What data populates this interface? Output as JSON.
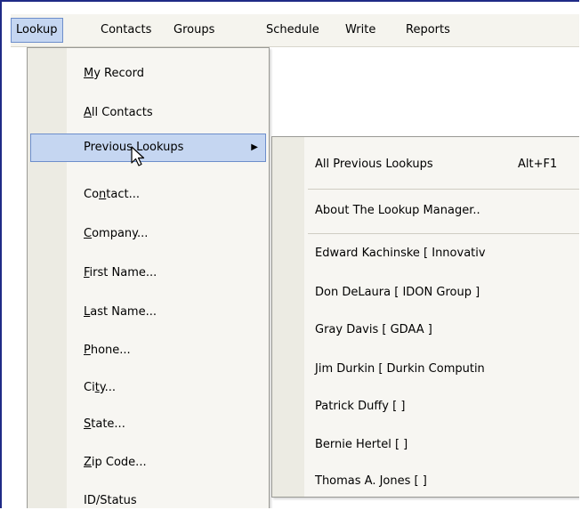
{
  "menubar": {
    "items": [
      "Lookup",
      "Contacts",
      "Groups",
      "Schedule",
      "Write",
      "Reports"
    ]
  },
  "lookup_menu": {
    "items": [
      {
        "pre": "",
        "ul": "M",
        "post": "y Record"
      },
      {
        "pre": "",
        "ul": "A",
        "post": "ll Contacts"
      },
      {
        "pre": "Previous Lookups",
        "ul": "",
        "post": "",
        "submenu": true
      },
      {
        "pre": "Co",
        "ul": "n",
        "post": "tact..."
      },
      {
        "pre": "",
        "ul": "C",
        "post": "ompany..."
      },
      {
        "pre": "",
        "ul": "F",
        "post": "irst Name..."
      },
      {
        "pre": "",
        "ul": "L",
        "post": "ast Name..."
      },
      {
        "pre": "",
        "ul": "P",
        "post": "hone..."
      },
      {
        "pre": "Ci",
        "ul": "t",
        "post": "y..."
      },
      {
        "pre": "",
        "ul": "S",
        "post": "tate..."
      },
      {
        "pre": "",
        "ul": "Z",
        "post": "ip Code..."
      },
      {
        "pre": "ID/Status",
        "ul": "",
        "post": ""
      }
    ]
  },
  "previous_lookups_menu": {
    "all_label": "All Previous Lookups",
    "all_shortcut": "Alt+F1",
    "about_label": "About The Lookup Manager..",
    "recent": [
      "Edward Kachinske [ Innovativ",
      "Don DeLaura [ IDON Group ]",
      "Gray Davis [ GDAA ]",
      "Jim Durkin [ Durkin Computin",
      "Patrick Duffy [ ]",
      "Bernie Hertel [ ]",
      "Thomas A. Jones [ ]"
    ]
  },
  "colors": {
    "frame": "#1f2a86",
    "highlight": "#c5d6f1",
    "highlight_border": "#6d8ecb"
  }
}
